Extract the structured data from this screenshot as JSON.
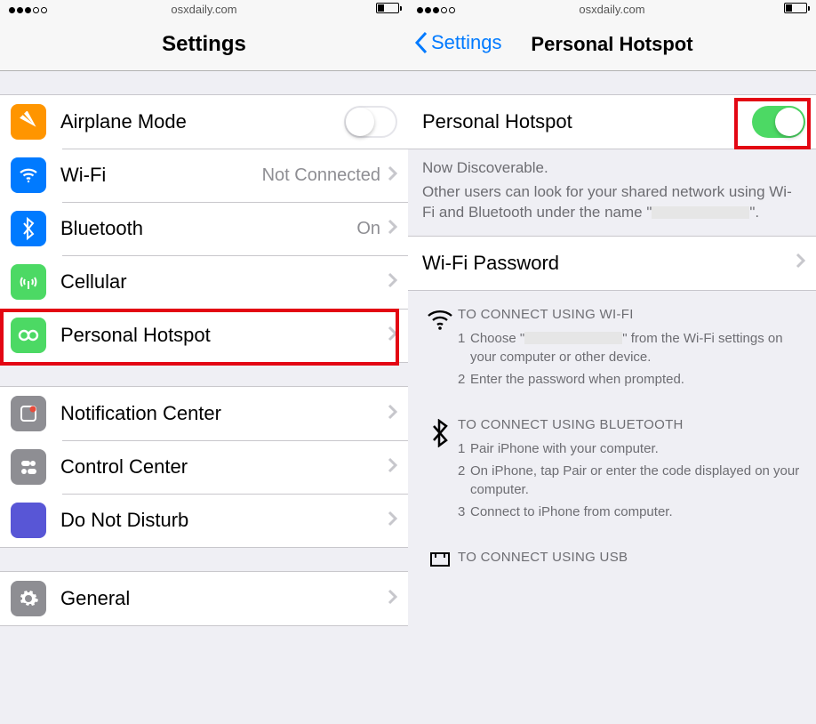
{
  "status": {
    "site": "osxdaily.com"
  },
  "left": {
    "title": "Settings",
    "rows": {
      "airplane": "Airplane Mode",
      "wifi": "Wi-Fi",
      "wifi_detail": "Not Connected",
      "bt": "Bluetooth",
      "bt_detail": "On",
      "cell": "Cellular",
      "hotspot": "Personal Hotspot",
      "notif": "Notification Center",
      "cc": "Control Center",
      "dnd": "Do Not Disturb",
      "general": "General"
    }
  },
  "right": {
    "back": "Settings",
    "title": "Personal Hotspot",
    "toggle_label": "Personal Hotspot",
    "help_line1": "Now Discoverable.",
    "help_line2a": "Other users can look for your shared network using Wi-Fi and Bluetooth under the name \"",
    "help_line2b": "\".",
    "wifi_pw": "Wi-Fi Password",
    "wifi_block": {
      "title": "TO CONNECT USING WI-FI",
      "s1a": "Choose \"",
      "s1b": "\" from the Wi-Fi settings on your computer or other device.",
      "s2": "Enter the password when prompted."
    },
    "bt_block": {
      "title": "TO CONNECT USING BLUETOOTH",
      "s1": "Pair iPhone with your computer.",
      "s2": "On iPhone, tap Pair or enter the code displayed on your computer.",
      "s3": "Connect to iPhone from computer."
    },
    "usb_block": {
      "title": "TO CONNECT USING USB"
    }
  }
}
